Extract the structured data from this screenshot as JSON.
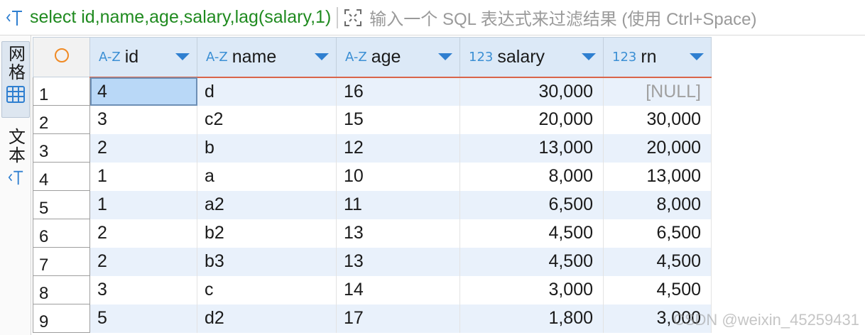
{
  "filter": {
    "query": "select id,name,age,salary,lag(salary,1)",
    "hint": "输入一个 SQL 表达式来过滤结果 (使用 Ctrl+Space)"
  },
  "side_tabs": [
    {
      "label": "网格",
      "icon": "grid-icon",
      "active": true
    },
    {
      "label": "文本",
      "icon": "text-icon",
      "active": false
    }
  ],
  "grid": {
    "columns": [
      {
        "type": "A-Z",
        "name": "id"
      },
      {
        "type": "A-Z",
        "name": "name"
      },
      {
        "type": "A-Z",
        "name": "age"
      },
      {
        "type": "123",
        "name": "salary"
      },
      {
        "type": "123",
        "name": "rn"
      }
    ],
    "rows": [
      {
        "num": "1",
        "cells": [
          "4",
          "d",
          "16",
          "30,000",
          "[NULL]"
        ]
      },
      {
        "num": "2",
        "cells": [
          "3",
          "c2",
          "15",
          "20,000",
          "30,000"
        ]
      },
      {
        "num": "3",
        "cells": [
          "2",
          "b",
          "12",
          "13,000",
          "20,000"
        ]
      },
      {
        "num": "4",
        "cells": [
          "1",
          "a",
          "10",
          "8,000",
          "13,000"
        ]
      },
      {
        "num": "5",
        "cells": [
          "1",
          "a2",
          "11",
          "6,500",
          "8,000"
        ]
      },
      {
        "num": "6",
        "cells": [
          "2",
          "b2",
          "13",
          "4,500",
          "6,500"
        ]
      },
      {
        "num": "7",
        "cells": [
          "2",
          "b3",
          "13",
          "4,500",
          "4,500"
        ]
      },
      {
        "num": "8",
        "cells": [
          "3",
          "c",
          "14",
          "3,000",
          "4,500"
        ]
      },
      {
        "num": "9",
        "cells": [
          "5",
          "d2",
          "17",
          "1,800",
          "3,000"
        ]
      }
    ]
  },
  "watermark": "CSDN @weixin_45259431",
  "colors": {
    "accent": "#2f7fd0",
    "header_bg": "#dce9f7",
    "query_text": "#1f8a1f",
    "header_underline": "#d9654a"
  }
}
